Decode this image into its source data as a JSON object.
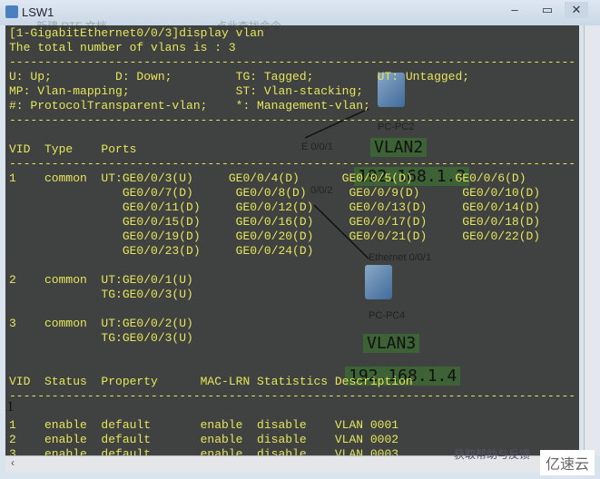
{
  "window": {
    "title": "LSW1",
    "bg_tab": "新建 RTF 文档",
    "bg_search": "点此查找命令",
    "bg_help": "获取帮助与反馈"
  },
  "topology": {
    "pc2": "PC-PC2",
    "pc4": "PC-PC4",
    "vlan2": "VLAN2",
    "vlan3": "VLAN3",
    "ip2": "192.168.1.2",
    "ip4": "192.168.1.4",
    "port_e001": "E 0/0/1",
    "port_002": "0/0/2",
    "port_eth001": "Ethernet 0/0/1"
  },
  "terminal": {
    "lines": [
      "[1-GigabitEthernet0/0/3]display vlan",
      "The total number of vlans is : 3",
      "--------------------------------------------------------------------------------",
      "U: Up;         D: Down;         TG: Tagged;         UT: Untagged;",
      "MP: Vlan-mapping;               ST: Vlan-stacking;",
      "#: ProtocolTransparent-vlan;    *: Management-vlan;",
      "--------------------------------------------------------------------------------",
      "",
      "VID  Type    Ports",
      "--------------------------------------------------------------------------------",
      "1    common  UT:GE0/0/3(U)     GE0/0/4(D)      GE0/0/5(D)      GE0/0/6(D)",
      "                GE0/0/7(D)      GE0/0/8(D)      GE0/0/9(D)      GE0/0/10(D)",
      "                GE0/0/11(D)     GE0/0/12(D)     GE0/0/13(D)     GE0/0/14(D)",
      "                GE0/0/15(D)     GE0/0/16(D)     GE0/0/17(D)     GE0/0/18(D)",
      "                GE0/0/19(D)     GE0/0/20(D)     GE0/0/21(D)     GE0/0/22(D)",
      "                GE0/0/23(D)     GE0/0/24(D)",
      "",
      "2    common  UT:GE0/0/1(U)",
      "             TG:GE0/0/3(U)",
      "",
      "3    common  UT:GE0/0/2(U)",
      "             TG:GE0/0/3(U)",
      "",
      "",
      "VID  Status  Property      MAC-LRN Statistics Description",
      "--------------------------------------------------------------------------------",
      "",
      "1    enable  default       enable  disable    VLAN 0001",
      "2    enable  default       enable  disable    VLAN 0002",
      "3    enable  default       enable  disable    VLAN 0003"
    ]
  },
  "artifact_text": "11",
  "watermark": "亿速云"
}
